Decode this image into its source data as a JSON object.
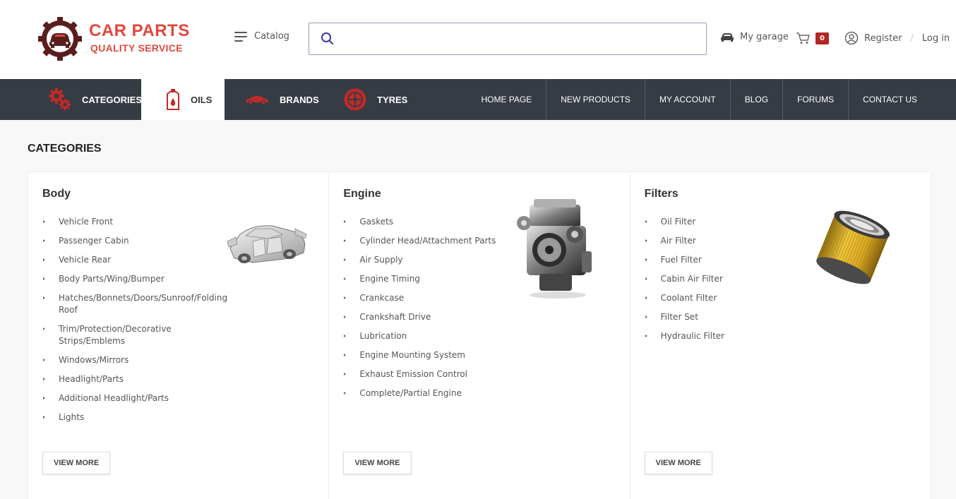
{
  "brand": {
    "line1": "CAR PARTS",
    "line2": "QUALITY SERVICE"
  },
  "header": {
    "catalog_label": "Catalog",
    "search_placeholder": "",
    "garage_label": "My garage",
    "cart_count": "0",
    "register_label": "Register",
    "separator": "/",
    "login_label": "Log in"
  },
  "nav": {
    "tabs": [
      {
        "label": "CATEGORIES",
        "icon": "gears-icon"
      },
      {
        "label": "OILS",
        "icon": "oil-canister-icon"
      },
      {
        "label": "BRANDS",
        "icon": "car-icon"
      },
      {
        "label": "TYRES",
        "icon": "tyre-icon"
      }
    ],
    "links": [
      "HOME PAGE",
      "NEW PRODUCTS",
      "MY ACCOUNT",
      "BLOG",
      "FORUMS",
      "CONTACT US"
    ]
  },
  "main": {
    "title": "CATEGORIES",
    "view_more_label": "VIEW MORE",
    "cards": [
      {
        "title": "Body",
        "items": [
          "Vehicle Front",
          "Passenger Cabin",
          "Vehicle Rear",
          "Body Parts/Wing/Bumper",
          "Hatches/Bonnets/Doors/Sunroof/Folding Roof",
          "Trim/Protection/Decorative Strips/Emblems",
          "Windows/Mirrors",
          "Headlight/Parts",
          "Additional Headlight/Parts",
          "Lights"
        ]
      },
      {
        "title": "Engine",
        "items": [
          "Gaskets",
          "Cylinder Head/Attachment Parts",
          "Air Supply",
          "Engine Timing",
          "Crankcase",
          "Crankshaft Drive",
          "Lubrication",
          "Engine Mounting System",
          "Exhaust Emission Control",
          "Complete/Partial Engine"
        ]
      },
      {
        "title": "Filters",
        "items": [
          "Oil Filter",
          "Air Filter",
          "Fuel Filter",
          "Cabin Air Filter",
          "Coolant Filter",
          "Filter Set",
          "Hydraulic Filter"
        ]
      }
    ]
  },
  "colors": {
    "brand_red": "#e2473d",
    "nav_bg": "#363c44",
    "badge": "#b52525"
  }
}
